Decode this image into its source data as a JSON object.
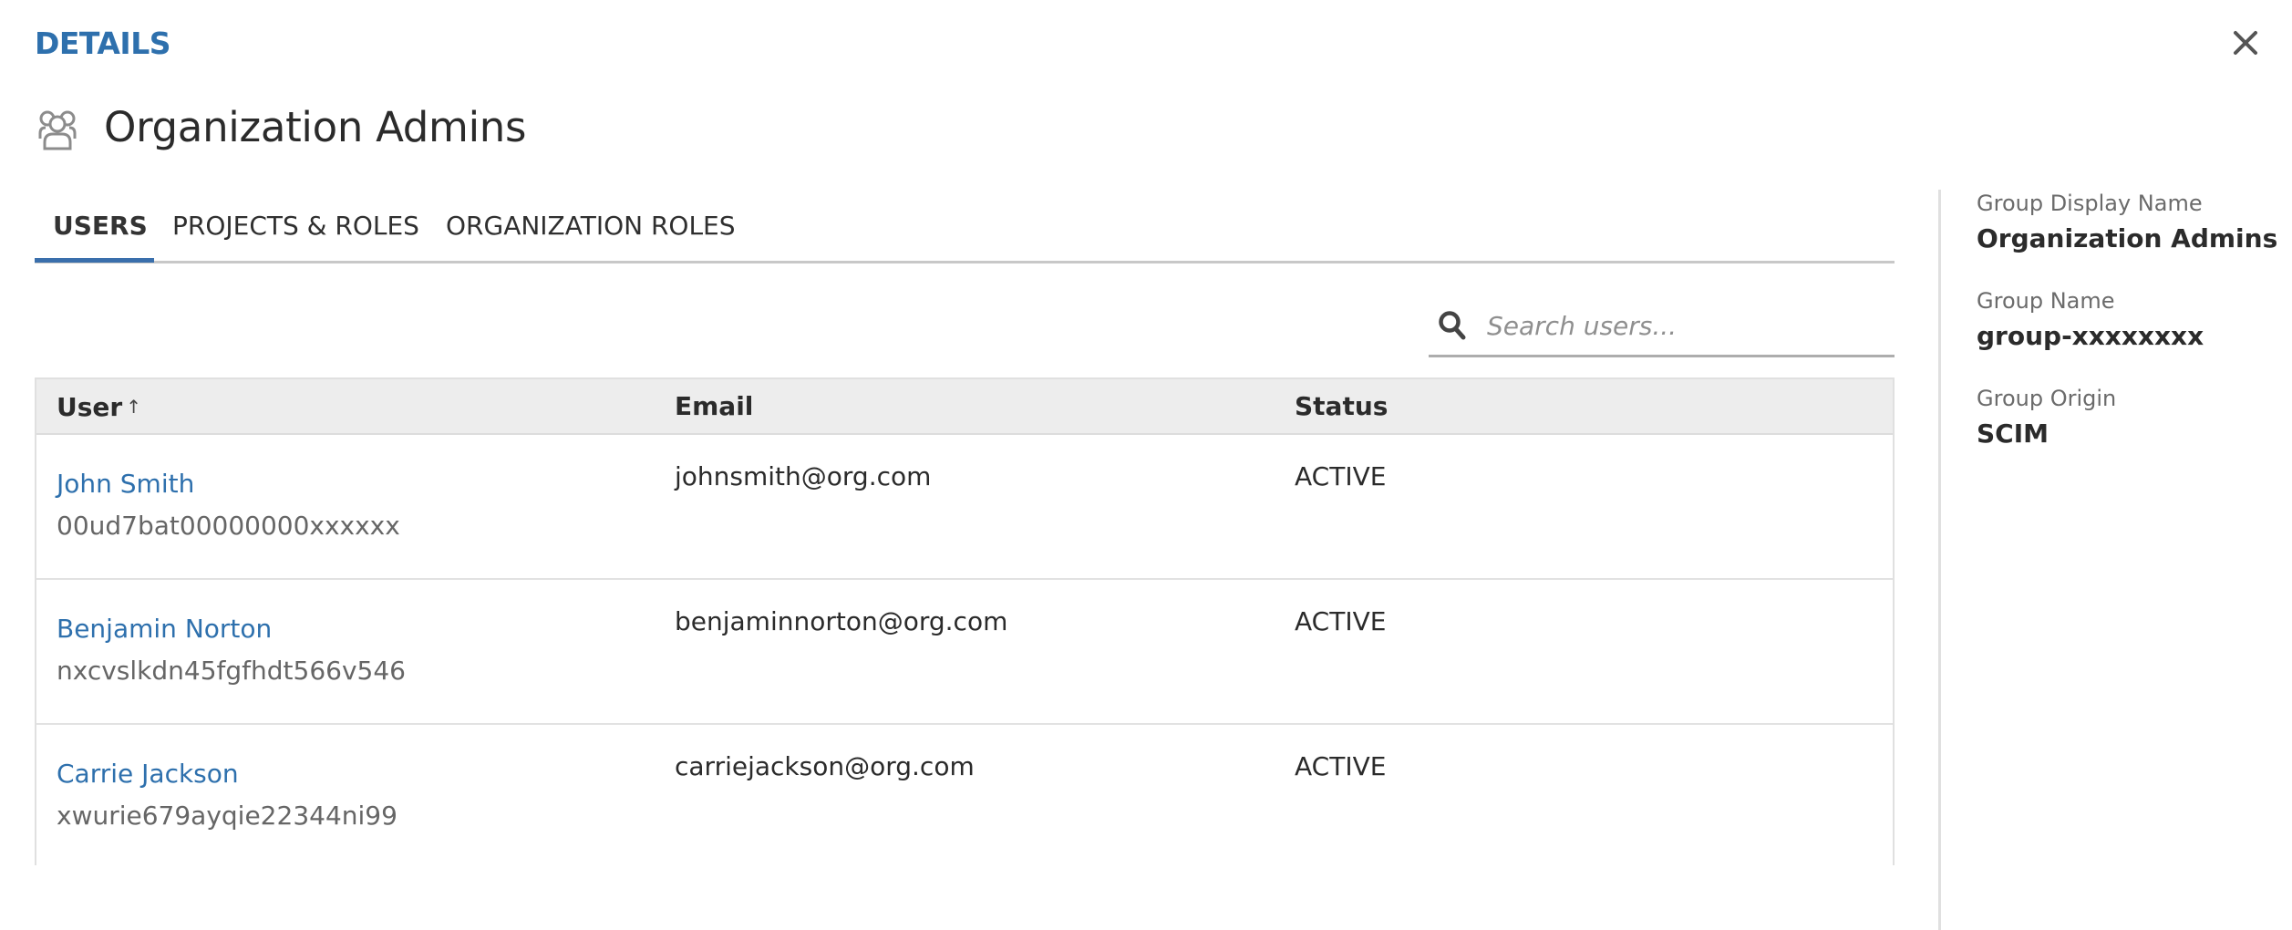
{
  "header": {
    "section_label": "DETAILS",
    "close_icon": "close-icon",
    "group_icon": "users-group-icon",
    "title": "Organization Admins"
  },
  "tabs": [
    {
      "label": "USERS",
      "active": true
    },
    {
      "label": "PROJECTS & ROLES",
      "active": false
    },
    {
      "label": "ORGANIZATION ROLES",
      "active": false
    }
  ],
  "search": {
    "icon": "search-icon",
    "placeholder": "Search users...",
    "value": ""
  },
  "table": {
    "columns": [
      {
        "label": "User",
        "sort": "ascending",
        "sort_indicator": "↑"
      },
      {
        "label": "Email"
      },
      {
        "label": "Status"
      }
    ],
    "rows": [
      {
        "name": "John Smith",
        "id": "00ud7bat00000000xxxxxx",
        "email": "johnsmith@org.com",
        "status": "ACTIVE"
      },
      {
        "name": "Benjamin Norton",
        "id": "nxcvslkdn45fgfhdt566v546",
        "email": "benjaminnorton@org.com",
        "status": "ACTIVE"
      },
      {
        "name": "Carrie Jackson",
        "id": "xwurie679ayqie22344ni99",
        "email": "carriejackson@org.com",
        "status": "ACTIVE"
      }
    ]
  },
  "side_panel": {
    "fields": [
      {
        "label": "Group Display Name",
        "value": "Organization Admins"
      },
      {
        "label": "Group Name",
        "value": "group-xxxxxxxx"
      },
      {
        "label": "Group Origin",
        "value": "SCIM"
      }
    ]
  },
  "colors": {
    "accent": "#2e70ad",
    "tab_indicator": "#3a6fac",
    "header_bg": "#ededed",
    "border": "#e0e0e0",
    "text": "#2b2b2b",
    "muted_text": "#666666"
  }
}
